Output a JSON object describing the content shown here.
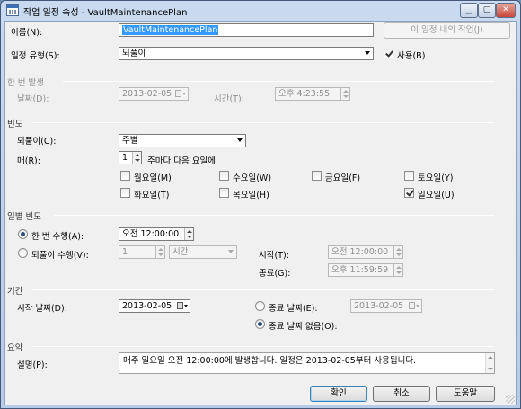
{
  "window": {
    "title": "작업 일정 속성 - VaultMaintenancePlan"
  },
  "name": {
    "label": "이름(N):",
    "value": "VaultMaintenancePlan",
    "jobs_button": "이 일정 내의 작업(J)"
  },
  "schedule_type": {
    "label": "일정 유형(S):",
    "value": "되풀이",
    "enabled_label": "사용(B)",
    "enabled": true
  },
  "one_time": {
    "title": "한 번 발생",
    "date_label": "날짜(D):",
    "date_value": "2013-02-05",
    "time_label": "시간(T):",
    "time_value": "오후  4:23:55"
  },
  "frequency": {
    "title": "빈도",
    "occurs_label": "되풀이(C):",
    "occurs_value": "주별",
    "every_label": "매(R):",
    "every_value": "1",
    "every_suffix": "주마다 다음 요일에",
    "days": [
      {
        "label": "월요일(M)",
        "checked": false
      },
      {
        "label": "수요일(W)",
        "checked": false
      },
      {
        "label": "금요일(F)",
        "checked": false
      },
      {
        "label": "토요일(Y)",
        "checked": false
      },
      {
        "label": "화요일(T)",
        "checked": false
      },
      {
        "label": "목요일(H)",
        "checked": false
      },
      {
        "label": "일요일(U)",
        "checked": true
      }
    ]
  },
  "daily": {
    "title": "일별 빈도",
    "once_label": "한 번 수행(A):",
    "once_value": "오전 12:00:00",
    "once_selected": true,
    "every_label": "되풀이 수행(V):",
    "every_value": "1",
    "every_unit": "시간",
    "every_selected": false,
    "start_label": "시작(T):",
    "start_value": "오전 12:00:00",
    "end_label": "종료(G):",
    "end_value": "오후 11:59:59"
  },
  "duration": {
    "title": "기간",
    "start_label": "시작 날짜(D):",
    "start_value": "2013-02-05",
    "end_label": "종료 날짜(E):",
    "end_value": "2013-02-05",
    "end_selected": false,
    "no_end_label": "종료 날짜 없음(O):",
    "no_end_selected": true
  },
  "summary": {
    "title": "요약",
    "desc_label": "설명(P):",
    "desc_value": "매주 일요일 오전 12:00:00에 발생합니다. 일정은 2013-02-05부터 사용됩니다."
  },
  "buttons": {
    "ok": "확인",
    "cancel": "취소",
    "help": "도움말"
  }
}
